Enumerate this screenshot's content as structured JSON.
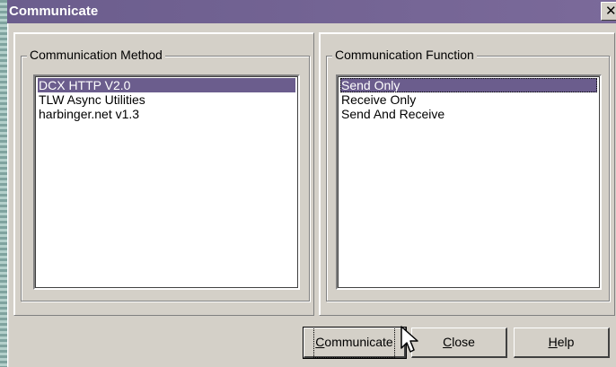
{
  "window": {
    "title": "Communicate",
    "close_glyph": "✕"
  },
  "method_group": {
    "legend": "Communication Method",
    "items": [
      "DCX HTTP V2.0",
      "TLW Async Utilities",
      "harbinger.net v1.3"
    ],
    "selected_index": 0
  },
  "function_group": {
    "legend": "Communication Function",
    "items": [
      "Send Only",
      "Receive Only",
      "Send And Receive"
    ],
    "selected_index": 0
  },
  "buttons": {
    "communicate": {
      "mnemonic": "C",
      "rest": "ommunicate"
    },
    "close": {
      "mnemonic": "C",
      "rest": "lose"
    },
    "help": {
      "mnemonic": "H",
      "rest": "elp"
    }
  },
  "colors": {
    "title_bar": "#6b5d8d",
    "selection": "#6b5d8d",
    "face": "#d4d0c8"
  },
  "icons": [
    "close-icon",
    "mouse-cursor-icon"
  ]
}
